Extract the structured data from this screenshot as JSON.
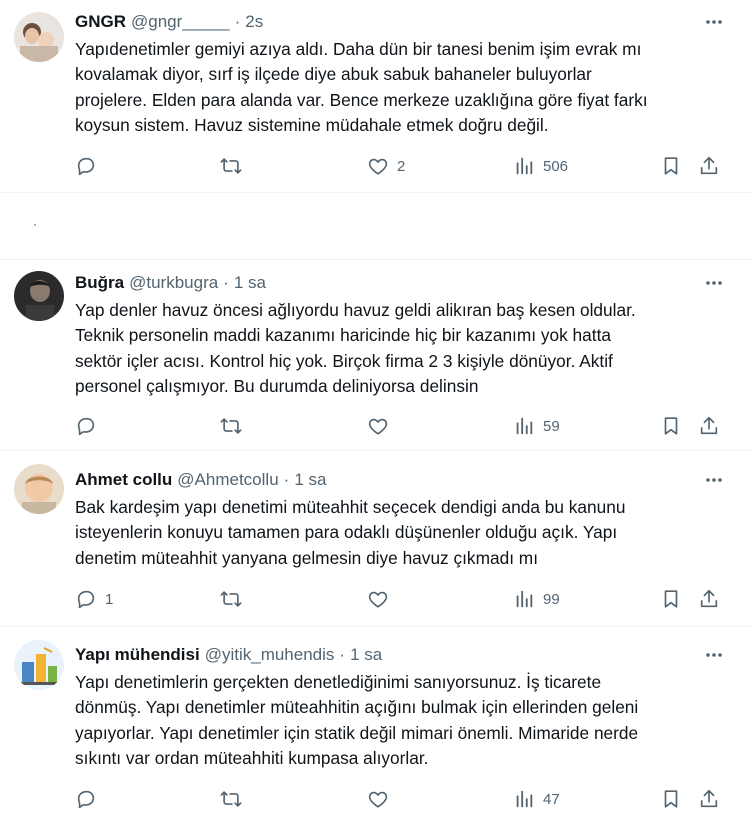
{
  "tweets": [
    {
      "name": "GNGR",
      "handle": "@gngr_____",
      "time": "2s",
      "text": "Yapıdenetimler gemiyi azıya aldı. Daha dün bir tanesi benim işim evrak mı\nkovalamak diyor, sırf iş ilçede diye abuk sabuk bahaneler buluyorlar\nprojelere. Elden para alanda var. Bence merkeze uzaklığına göre fiyat farkı\nkoysun sistem. Havuz sistemine müdahale etmek doğru değil.",
      "replies": "",
      "reposts": "",
      "likes": "2",
      "views": "506",
      "avatar_icon": "avatar-woman-child-photo"
    },
    {
      "name": "Buğra",
      "handle": "@turkbugra",
      "time": "1 sa",
      "text": "Yap denler havuz öncesi ağlıyordu havuz geldi alikıran baş kesen oldular.\nTeknik personelin maddi kazanımı haricinde hiç bir kazanımı yok hatta\nsektör içler acısı. Kontrol hiç yok. Birçok firma 2 3 kişiyle dönüyor. Aktif\npersonel çalışmıyor. Bu durumda deliniyorsa delinsin",
      "replies": "",
      "reposts": "",
      "likes": "",
      "views": "59",
      "avatar_icon": "avatar-dark-portrait"
    },
    {
      "name": "Ahmet collu",
      "handle": "@Ahmetcollu",
      "time": "1 sa",
      "text": "Bak kardeşim yapı denetimi müteahhit seçecek dendigi anda bu kanunu\nisteyenlerin konuyu tamamen para odaklı düşünenler olduğu açık. Yapı\ndenetim müteahhit yanyana gelmesin diye havuz çıkmadı mı",
      "replies": "1",
      "reposts": "",
      "likes": "",
      "views": "99",
      "avatar_icon": "avatar-child-photo"
    },
    {
      "name": "Yapı mühendisi",
      "handle": "@yitik_muhendis",
      "time": "1 sa",
      "text": "Yapı denetimlerin gerçekten denetlediğinimi sanıyorsunuz. İş ticarete\ndönmüş. Yapı denetimler müteahhitin açığını bulmak için ellerinden geleni\nyapıyorlar. Yapı denetimler için statik değil mimari önemli. Mimaride nerde\nsıkıntı var ordan müteahhiti kumpasa alıyorlar.",
      "replies": "",
      "reposts": "",
      "likes": "",
      "views": "47",
      "avatar_icon": "avatar-construction-illustration"
    }
  ],
  "colors": {
    "text_primary": "#0f1419",
    "text_secondary": "#536471",
    "divider": "#eff3f4"
  },
  "icons": {
    "reply": "reply-icon",
    "repost": "repost-icon",
    "like": "like-icon",
    "views": "views-icon",
    "bookmark": "bookmark-icon",
    "share": "share-icon",
    "more": "more-icon"
  }
}
